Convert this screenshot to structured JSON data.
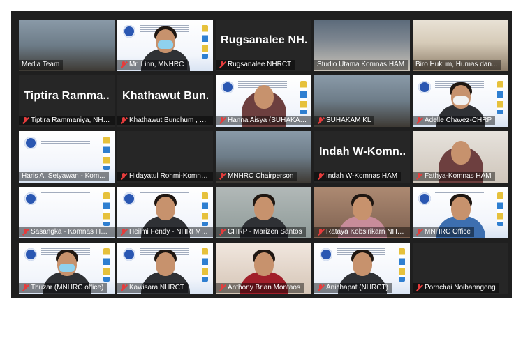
{
  "meeting": {
    "tiles": [
      {
        "name": "Media Team",
        "show_mic": false,
        "active": true,
        "bg": "room"
      },
      {
        "name": "Mr. Linn, MNHRC",
        "show_mic": true,
        "bg": "slide",
        "person": "mask"
      },
      {
        "name": "Rugsanalee NHRCT",
        "big_name": "Rugsanalee NH...",
        "show_mic": true,
        "bg": "dark"
      },
      {
        "name": "Studio Utama Komnas HAM",
        "show_mic": false,
        "bg": "studio"
      },
      {
        "name": "Biro Hukum, Humas dan...",
        "show_mic": false,
        "bg": "office"
      },
      {
        "name": "Tiptira Rammaniya, NHRCT",
        "big_name": "Tiptira Ramma...",
        "show_mic": true,
        "bg": "dark"
      },
      {
        "name": "Khathawut Bunchum , N...",
        "big_name": "Khathawut Bun...",
        "show_mic": true,
        "bg": "dark"
      },
      {
        "name": "Hanna Aisya (SUHAKAM)",
        "show_mic": true,
        "bg": "slide",
        "person": "hijab"
      },
      {
        "name": "SUHAKAM KL",
        "show_mic": true,
        "bg": "room"
      },
      {
        "name": "Adelle Chavez-CHRP",
        "show_mic": true,
        "bg": "slide",
        "person": "mask-white"
      },
      {
        "name": "Haris A. Setyawan - Kom...",
        "show_mic": false,
        "bg": "slide"
      },
      {
        "name": "Hidayatul Rohmi-Komnas ...",
        "show_mic": true,
        "bg": "dark"
      },
      {
        "name": "MNHRC Chairperson",
        "show_mic": true,
        "bg": "room"
      },
      {
        "name": "Indah W-Komnas HAM",
        "big_name": "Indah W-Komn...",
        "show_mic": true,
        "bg": "dark"
      },
      {
        "name": "Fathya-Komnas HAM",
        "show_mic": true,
        "bg": "person",
        "person": "hijab"
      },
      {
        "name": "Sasangka - Komnas HAM",
        "show_mic": true,
        "bg": "slide"
      },
      {
        "name": "Heilmi Fendy - NHRI Malai...",
        "show_mic": true,
        "bg": "slide",
        "person": "plain"
      },
      {
        "name": "CHRP - Marizen Santos",
        "show_mic": true,
        "bg": "person2",
        "person": "plain"
      },
      {
        "name": "Rataya Kobsirikarn NHRCT",
        "show_mic": true,
        "bg": "person6",
        "person": "pink"
      },
      {
        "name": "MNHRC Office",
        "show_mic": true,
        "bg": "slide",
        "person": "blue"
      },
      {
        "name": "Thuzar (MNHRC office)",
        "show_mic": true,
        "bg": "slide",
        "person": "mask"
      },
      {
        "name": "Kawisara NHRCT",
        "show_mic": true,
        "bg": "slide",
        "person": "plain"
      },
      {
        "name": "Anthony Brian Montaos",
        "show_mic": true,
        "bg": "person4",
        "person": "red"
      },
      {
        "name": "Anichapat (NHRCT)",
        "show_mic": true,
        "bg": "slide",
        "person": "plain"
      },
      {
        "name": "Pornchai Noibanngong",
        "show_mic": true,
        "bg": "dark"
      }
    ]
  },
  "colors": {
    "grid_bg": "#1f1f1f",
    "active_outline": "#d8e23a",
    "muted_mic": "#e63c3c"
  }
}
